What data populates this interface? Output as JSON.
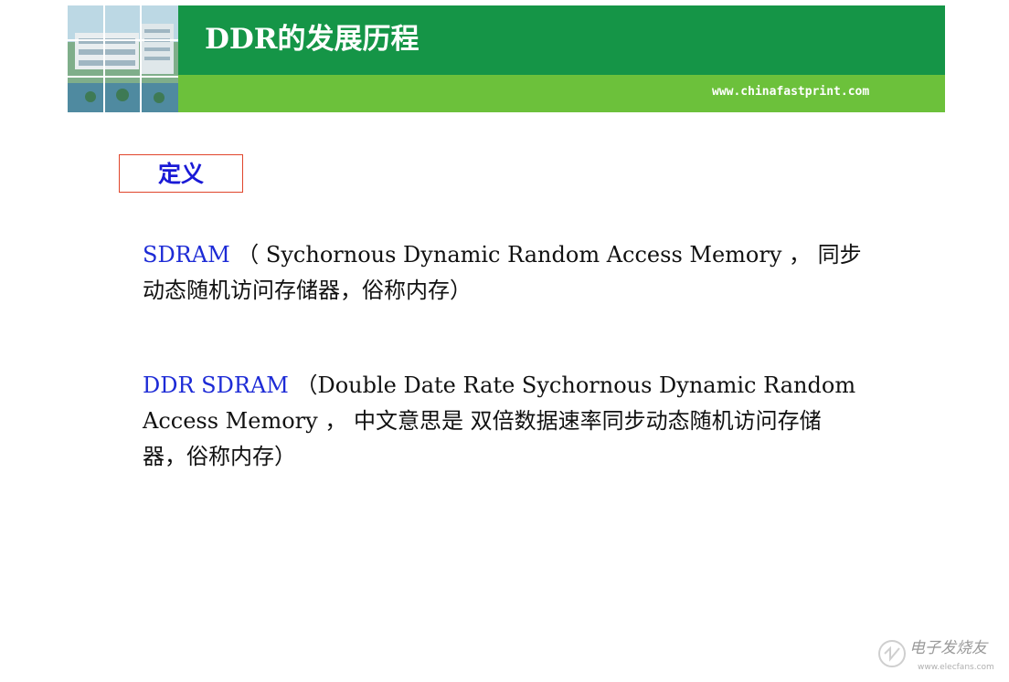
{
  "header": {
    "title": "DDR的发展历程",
    "url": "www.chinafastprint.com",
    "colors": {
      "dark_green": "#159547",
      "light_green": "#6cc13b"
    }
  },
  "section": {
    "label": "定义",
    "border_color": "#e0452b",
    "label_color": "#1a1ad6"
  },
  "paragraphs": [
    {
      "term": "SDRAM",
      "line1_rest": " （ Sychornous Dynamic Random Access Memory ， 同步",
      "line2": "动态随机访问存储器，俗称内存）"
    },
    {
      "term": "DDR SDRAM",
      "line1_rest": " （Double Date Rate Sychornous Dynamic Random",
      "line2": "Access Memory ， 中文意思是 双倍数据速率同步动态随机访问存储",
      "line3": "器，俗称内存）"
    }
  ],
  "watermark": {
    "text": "电子发烧友",
    "sub": "www.elecfans.com"
  }
}
